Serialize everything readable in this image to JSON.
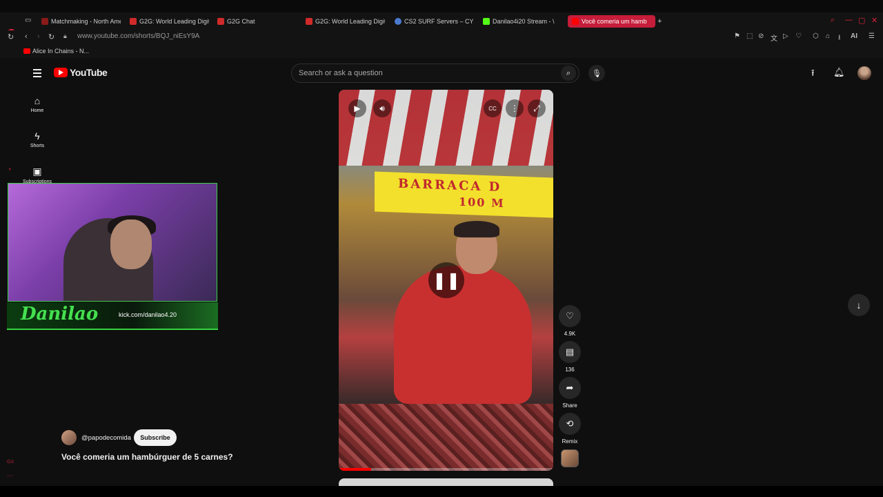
{
  "browser": {
    "tabs": [
      {
        "label": "Matchmaking - North Amer",
        "icon": "matchmaking-icon",
        "color": "#8a1a1a"
      },
      {
        "label": "G2G: World Leading Digita",
        "icon": "g2g-icon",
        "color": "#d02a2a"
      },
      {
        "label": "G2G Chat",
        "icon": "g2g-icon",
        "color": "#d02a2a"
      },
      {
        "label": "G2G: World Leading Digita",
        "icon": "g2g-icon",
        "color": "#d02a2a"
      },
      {
        "label": "CS2 SURF Servers – CYBE",
        "icon": "cs2-icon",
        "color": "#4a7ad0"
      },
      {
        "label": "Danilao4i20 Stream - \\",
        "icon": "kick-icon",
        "color": "#53fc18"
      },
      {
        "label": "Você comeria um hamb",
        "icon": "youtube-icon",
        "color": "#ff0000",
        "active": true
      }
    ],
    "new_tab": "+",
    "url": "www.youtube.com/shorts/BQJ_niEsY9A",
    "bookmark": "Alice In Chains - N...",
    "ai_label": "AI",
    "accent": "#e0233b"
  },
  "youtube": {
    "logo_text": "YouTube",
    "search_placeholder": "Search or ask a question",
    "nav": [
      {
        "label": "Home",
        "icon": "home-icon"
      },
      {
        "label": "Shorts",
        "icon": "shorts-icon"
      },
      {
        "label": "Subscriptions",
        "icon": "subscriptions-icon"
      }
    ],
    "actions": {
      "likes": "4.9K",
      "comments": "136",
      "share": "Share",
      "remix": "Remix"
    },
    "channel": "@papodecomida",
    "subscribe": "Subscribe",
    "title": "Você comeria um hambúrguer de 5 carnes?",
    "progress": 0.15
  },
  "video_frame": {
    "sign_line1": "BARRACA D",
    "sign_line2": "100 M"
  },
  "stream_overlay": {
    "signature": "Danilao",
    "kick_url": "kick.com/danilao4.20"
  }
}
